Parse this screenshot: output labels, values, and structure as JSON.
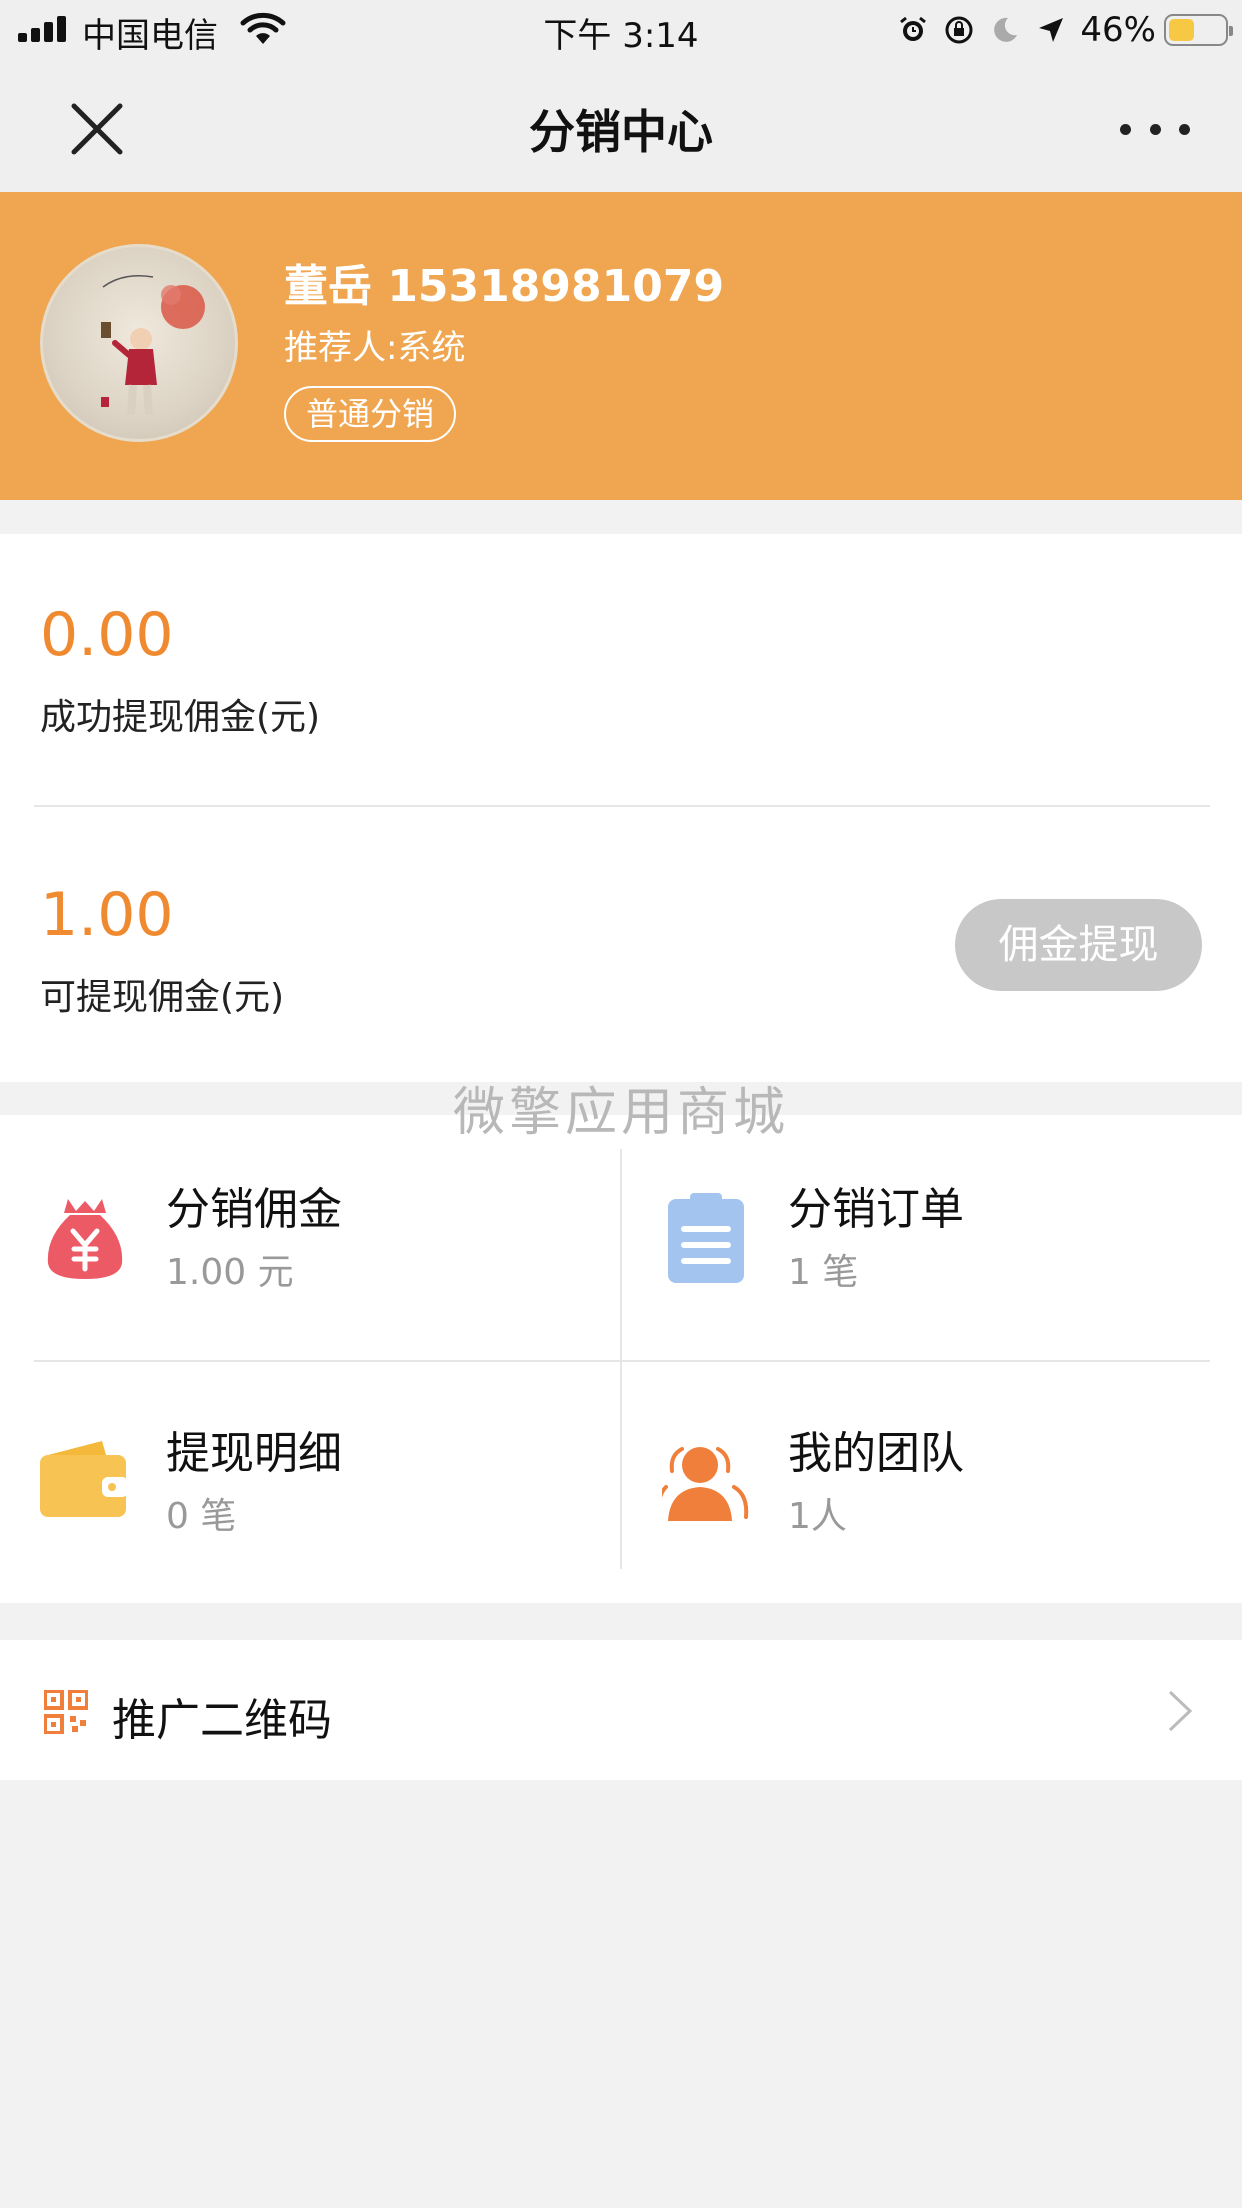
{
  "status_bar": {
    "carrier": "中国电信",
    "time": "下午 3:14",
    "battery_percent": "46%",
    "battery_level": 0.46,
    "icons": [
      "signal-icon",
      "wifi-icon",
      "alarm-icon",
      "orientation-lock-icon",
      "moon-icon",
      "location-icon",
      "battery-icon"
    ]
  },
  "nav": {
    "title": "分销中心",
    "close_icon": "close-icon",
    "more_icon": "more-icon"
  },
  "profile": {
    "name": "董岳 15318981079",
    "referrer": "推荐人:系统",
    "level": "普通分销",
    "background_color": "#f0a650"
  },
  "commission": {
    "withdrawn_amount": "0.00",
    "withdrawn_label": "成功提现佣金(元)",
    "available_amount": "1.00",
    "available_label": "可提现佣金(元)",
    "withdraw_button": "佣金提现",
    "accent_color": "#f08a30"
  },
  "watermark": "微擎应用商城",
  "grid": [
    {
      "title": "分销佣金",
      "sub": "1.00 元",
      "icon": "money-bag-icon",
      "color": "#ec5a66"
    },
    {
      "title": "分销订单",
      "sub": "1 笔",
      "icon": "clipboard-icon",
      "color": "#a3c4ef"
    },
    {
      "title": "提现明细",
      "sub": "0 笔",
      "icon": "wallet-icon",
      "color": "#f7c453"
    },
    {
      "title": "我的团队",
      "sub": "1人",
      "icon": "team-icon",
      "color": "#ef7f3b"
    }
  ],
  "promo": {
    "label": "推广二维码",
    "icon": "qr-code-icon",
    "arrow_icon": "chevron-right-icon"
  }
}
